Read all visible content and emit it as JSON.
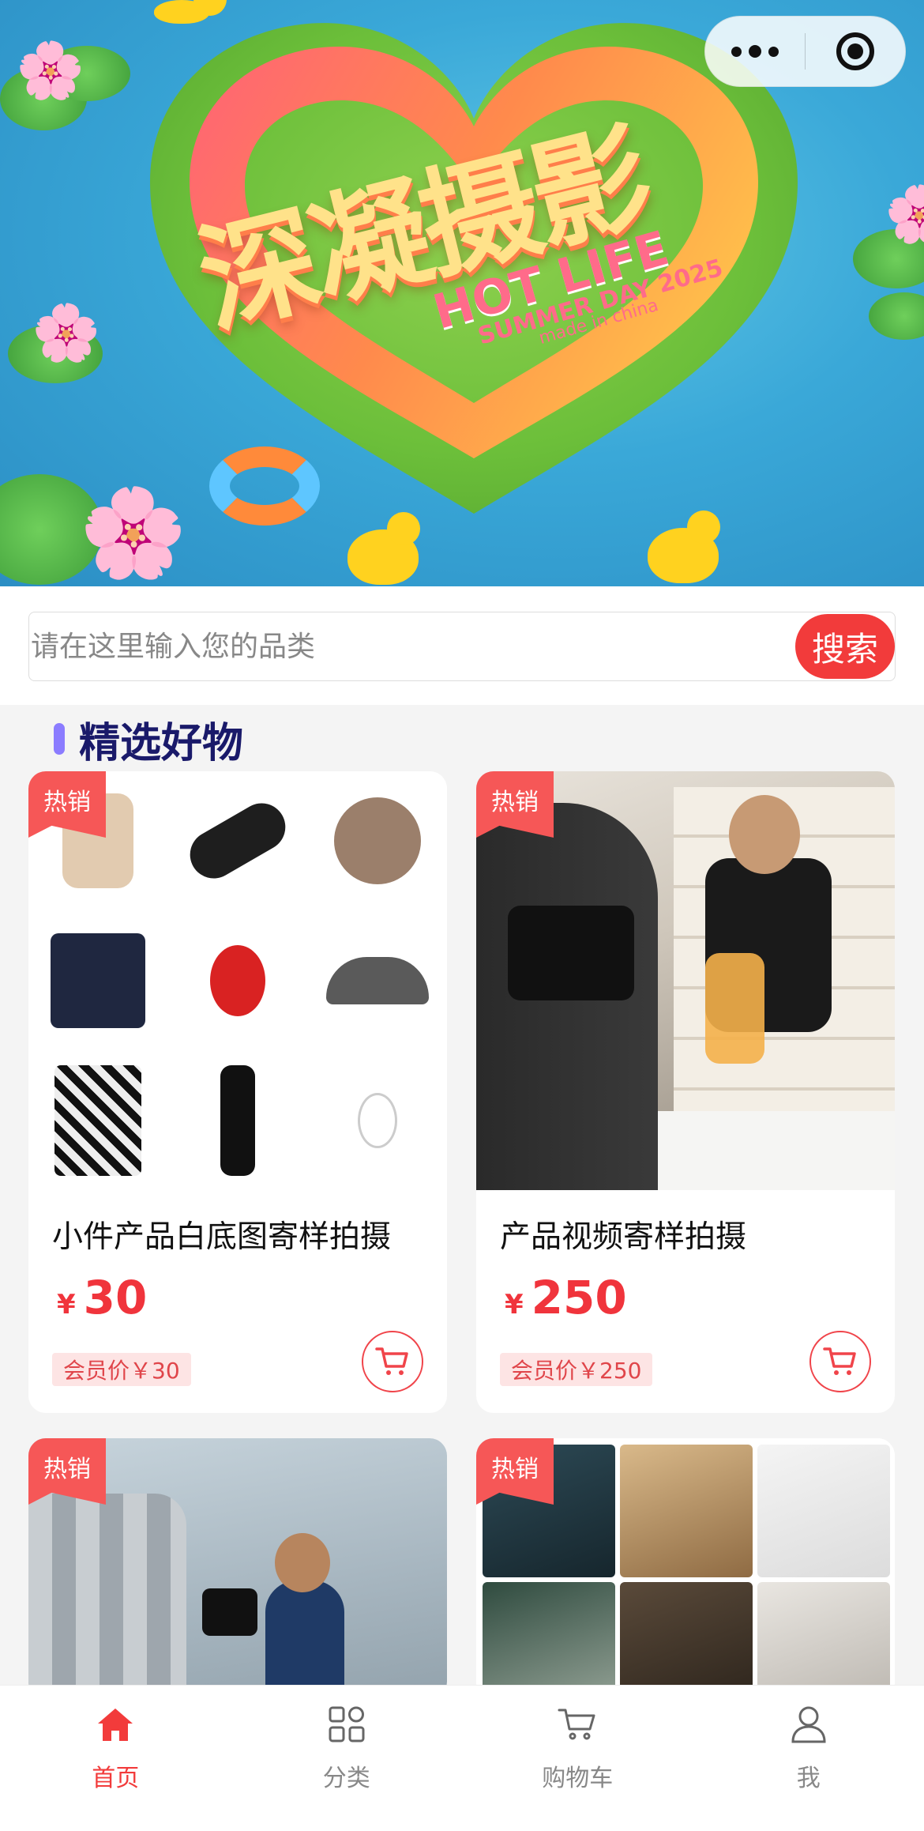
{
  "capsule": {
    "more_icon": "more-dots-icon",
    "close_icon": "target-close-icon"
  },
  "banner": {
    "title": "深凝摄影",
    "sub1": "HOT LIFE",
    "sub2": "SUMMER DAY 2025",
    "sub3": "made in china"
  },
  "search": {
    "placeholder": "请在这里输入您的品类",
    "button": "搜索"
  },
  "section": {
    "title": "精选好物"
  },
  "products": [
    {
      "tag": "热销",
      "name": "小件产品白底图寄样拍摄",
      "currency": "¥",
      "price": "30",
      "member_price": "会员价￥30"
    },
    {
      "tag": "热销",
      "name": "产品视频寄样拍摄",
      "currency": "¥",
      "price": "250",
      "member_price": "会员价￥250"
    },
    {
      "tag": "热销"
    },
    {
      "tag": "热销"
    }
  ],
  "colors": {
    "accent": "#f23b3b",
    "tag": "#f65757",
    "section_bar": "#8b7cff",
    "section_text": "#1a1a6a"
  },
  "tabbar": {
    "items": [
      {
        "label": "首页",
        "icon": "home-icon",
        "active": true
      },
      {
        "label": "分类",
        "icon": "category-grid-icon",
        "active": false
      },
      {
        "label": "购物车",
        "icon": "cart-icon",
        "active": false
      },
      {
        "label": "我",
        "icon": "user-icon",
        "active": false
      }
    ]
  }
}
